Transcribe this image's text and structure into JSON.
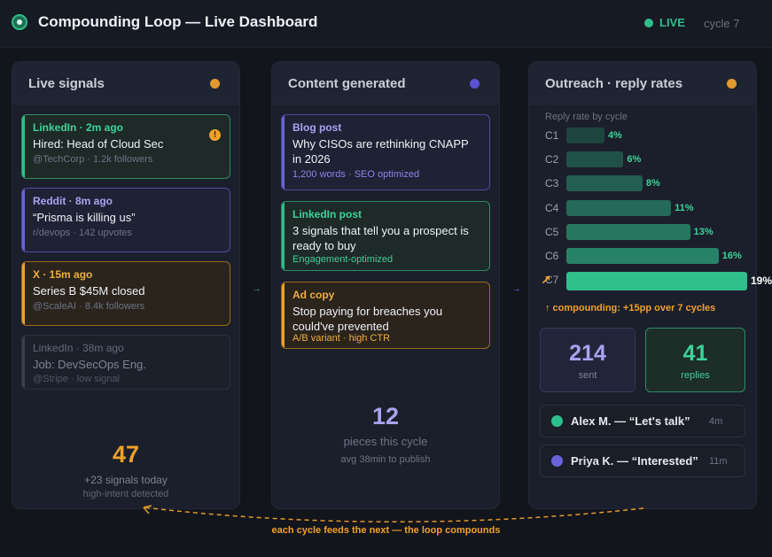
{
  "header": {
    "title": "Compounding Loop — Live Dashboard",
    "live_label": "LIVE",
    "cycle_label": "cycle 7"
  },
  "colors": {
    "green": "#2fbf8c",
    "purple": "#6a64d8",
    "orange": "#f0a12a"
  },
  "signals": {
    "title": "Live signals",
    "cards": [
      {
        "meta": "LinkedIn · 2m ago",
        "title": "Hired: Head of Cloud Sec",
        "sub": "@TechCorp · 1.2k followers",
        "alert": "!"
      },
      {
        "meta": "Reddit · 8m ago",
        "title": "“Prisma is killing us”",
        "sub": "r/devops · 142 upvotes"
      },
      {
        "meta": "X · 15m ago",
        "title": "Series B $45M closed",
        "sub": "@ScaleAI · 8.4k followers"
      },
      {
        "meta": "LinkedIn · 38m ago",
        "title": "Job: DevSecOps Eng.",
        "sub": "@Stripe · low signal"
      }
    ],
    "total": "47",
    "today": "+23 signals today",
    "note": "high-intent detected"
  },
  "content": {
    "title": "Content generated",
    "cards": [
      {
        "meta": "Blog post",
        "title": "Why CISOs are rethinking CNAPP in 2026",
        "sub": "1,200 words · SEO optimized"
      },
      {
        "meta": "LinkedIn post",
        "title": "3 signals that tell you a prospect is ready to buy",
        "sub": "Engagement-optimized"
      },
      {
        "meta": "Ad copy",
        "title": "Stop paying for breaches you could've prevented",
        "sub": "A/B variant · high CTR"
      }
    ],
    "total": "12",
    "label": "pieces this cycle",
    "note": "avg 38min to publish"
  },
  "outreach": {
    "title": "Outreach · reply rates",
    "chart_caption": "Reply rate by cycle",
    "compounding_note": "↑ compounding: +15pp over 7 cycles",
    "sent_value": "214",
    "sent_label": "sent",
    "replies_value": "41",
    "replies_label": "replies",
    "replies": [
      {
        "text": "Alex M. — “Let's talk”",
        "time": "4m",
        "color": "#2fbf8c"
      },
      {
        "text": "Priya K. — “Interested”",
        "time": "11m",
        "color": "#6a64d8"
      }
    ]
  },
  "chart_data": {
    "type": "bar",
    "orientation": "horizontal",
    "title": "Reply rate by cycle",
    "categories": [
      "C1",
      "C2",
      "C3",
      "C4",
      "C5",
      "C6",
      "C7"
    ],
    "values": [
      4,
      6,
      8,
      11,
      13,
      16,
      19
    ],
    "value_labels": [
      "4%",
      "6%",
      "8%",
      "11%",
      "13%",
      "16%",
      "19%"
    ],
    "unit": "%",
    "xlim": [
      0,
      19
    ],
    "grid": false,
    "legend": "none"
  },
  "flow": {
    "arrow": "→",
    "loop_caption": "each cycle feeds the next — the loop compounds"
  }
}
